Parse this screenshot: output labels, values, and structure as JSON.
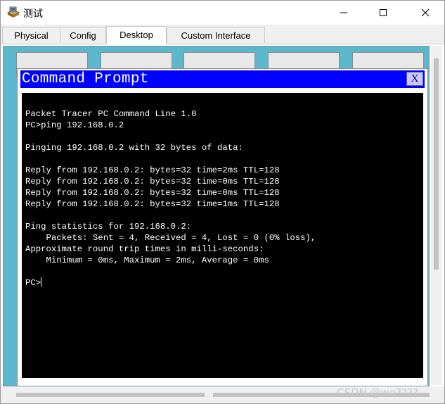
{
  "window": {
    "title": "测试",
    "controls": {
      "minimize_icon": "minimize-icon",
      "maximize_icon": "maximize-icon",
      "close_icon": "close-icon"
    }
  },
  "tabs": [
    {
      "label": "Physical",
      "active": false
    },
    {
      "label": "Config",
      "active": false
    },
    {
      "label": "Desktop",
      "active": true
    },
    {
      "label": "Custom Interface",
      "active": false
    }
  ],
  "command_prompt": {
    "title": "Command Prompt",
    "close_label": "X",
    "lines": [
      "Packet Tracer PC Command Line 1.0",
      "PC>ping 192.168.0.2",
      "",
      "Pinging 192.168.0.2 with 32 bytes of data:",
      "",
      "Reply from 192.168.0.2: bytes=32 time=2ms TTL=128",
      "Reply from 192.168.0.2: bytes=32 time=0ms TTL=128",
      "Reply from 192.168.0.2: bytes=32 time=0ms TTL=128",
      "Reply from 192.168.0.2: bytes=32 time=1ms TTL=128",
      "",
      "Ping statistics for 192.168.0.2:",
      "    Packets: Sent = 4, Received = 4, Lost = 0 (0% loss),",
      "Approximate round trip times in milli-seconds:",
      "    Minimum = 0ms, Maximum = 2ms, Average = 0ms",
      "",
      "PC>"
    ]
  },
  "watermark": "CSDN @wo????",
  "colors": {
    "desktop_background": "#5cb6cc",
    "prompt_title_bar": "#0000ff",
    "terminal_background": "#000000",
    "terminal_text": "#ffffff"
  }
}
